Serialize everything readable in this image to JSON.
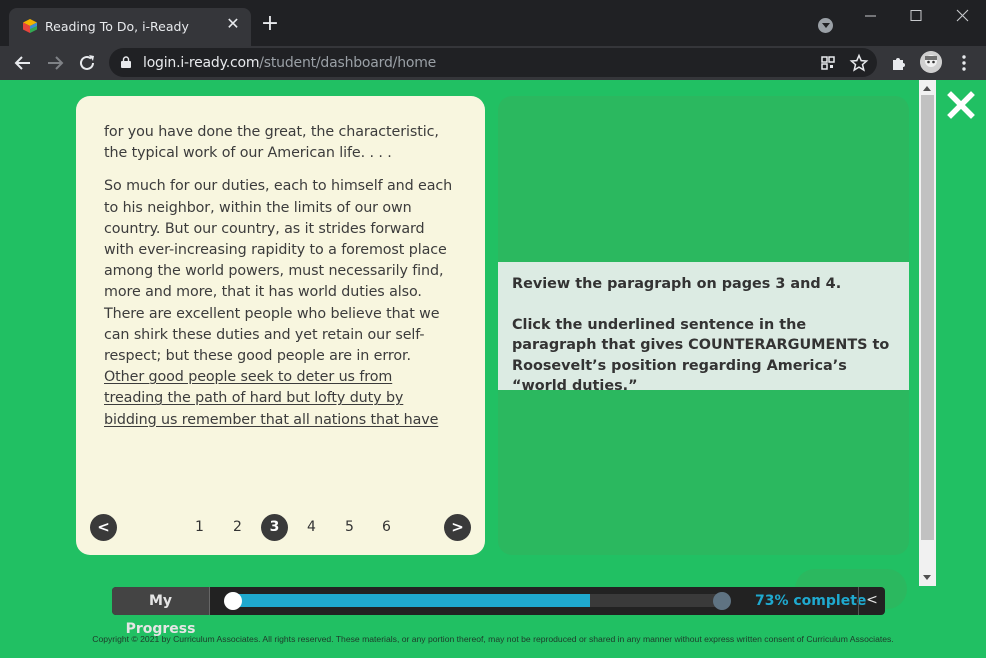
{
  "browser": {
    "tab_title": "Reading To Do, i-Ready",
    "url_host": "login.i-ready.com",
    "url_path": "/student/dashboard/home"
  },
  "passage": {
    "paragraph1": "for you have done the great, the characteristic, the typical work of our American life. . . .",
    "paragraph2_plain": "So much for our duties, each to himself and each to his neighbor, within the limits of our own country. But our country, as it strides forward with ever-increasing rapidity to a foremost place among the world powers, must necessarily find, more and more, that it has world duties also. There are excellent people who believe that we can shirk these duties and yet retain our self-respect; but these good people are in error. ",
    "paragraph2_underlined": "Other good people seek to deter us from treading the path of hard but lofty duty by bidding us remember that all nations that have"
  },
  "pager": {
    "prev_label": "<",
    "next_label": ">",
    "pages": [
      "1",
      "2",
      "3",
      "4",
      "5",
      "6"
    ],
    "current_page": "3"
  },
  "question": {
    "line1": "Review the paragraph on pages 3 and 4.",
    "line2": "Click the underlined sentence in the paragraph that gives COUNTERARGUMENTS to Roosevelt’s position regarding America’s “world duties.”"
  },
  "progress": {
    "label": "My Progress",
    "percent_text": "73% complete",
    "fill_fraction": 0.73,
    "collapse_label": "<",
    "fill_color": "#1fa9cf"
  },
  "footer": {
    "copyright": "Copyright © 2021 by Curriculum Associates. All rights reserved. These materials, or any portion thereof, may not be reproduced or shared in any manner without express written consent of Curriculum Associates."
  },
  "colors": {
    "background": "#21c063",
    "panel": "#2bb85f",
    "reader": "#f8f6df"
  }
}
